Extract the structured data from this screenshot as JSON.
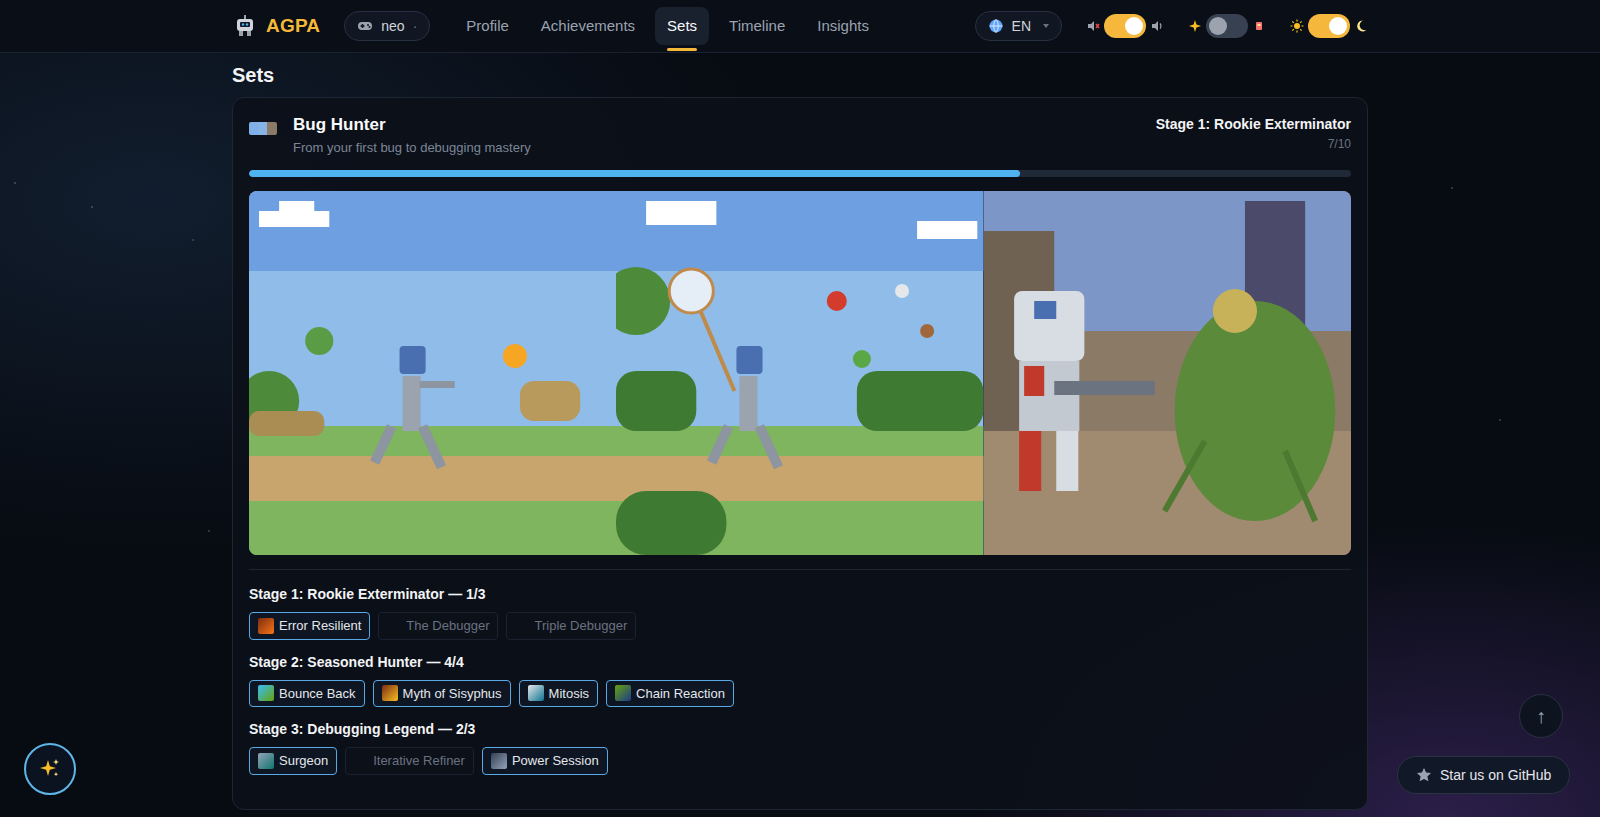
{
  "app": {
    "logo": "AGPA",
    "user": "neo",
    "user_suffix": "·"
  },
  "nav": [
    {
      "label": "Profile",
      "selected": false
    },
    {
      "label": "Achievements",
      "selected": false
    },
    {
      "label": "Sets",
      "selected": true
    },
    {
      "label": "Timeline",
      "selected": false
    },
    {
      "label": "Insights",
      "selected": false
    }
  ],
  "language": {
    "label": "EN"
  },
  "toggles": [
    {
      "name": "sound",
      "on": true
    },
    {
      "name": "effects",
      "on": false
    },
    {
      "name": "theme",
      "on": true
    }
  ],
  "page_title": "Sets",
  "set": {
    "title": "Bug Hunter",
    "subtitle": "From your first bug to debugging mastery",
    "current_stage": "Stage 1: Rookie Exterminator",
    "count": "7/10",
    "level": 0.7,
    "stages": [
      {
        "title": "Stage 1: Rookie Exterminator — 1/3",
        "achievements": [
          {
            "label": "Error Resilient",
            "earned": true
          },
          {
            "label": "The Debugger",
            "earned": false
          },
          {
            "label": "Triple Debugger",
            "earned": false
          }
        ]
      },
      {
        "title": "Stage 2: Seasoned Hunter — 4/4",
        "achievements": [
          {
            "label": "Bounce Back",
            "earned": true
          },
          {
            "label": "Myth of Sisyphus",
            "earned": true
          },
          {
            "label": "Mitosis",
            "earned": true
          },
          {
            "label": "Chain Reaction",
            "earned": true
          }
        ]
      },
      {
        "title": "Stage 3: Debugging Legend — 2/3",
        "achievements": [
          {
            "label": "Surgeon",
            "earned": true
          },
          {
            "label": "Iterative Refiner",
            "earned": false
          },
          {
            "label": "Power Session",
            "earned": true
          }
        ]
      }
    ]
  },
  "scroll_top": {
    "icon": "↑"
  },
  "github": {
    "label": "Star us on GitHub"
  }
}
